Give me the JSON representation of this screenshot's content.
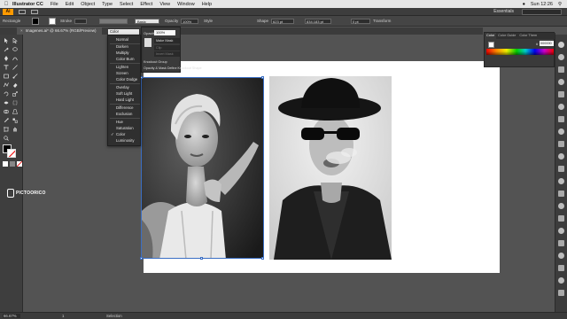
{
  "menubar": {
    "app_name": "Illustrator CC",
    "items": [
      "File",
      "Edit",
      "Object",
      "Type",
      "Select",
      "Effect",
      "View",
      "Window",
      "Help"
    ],
    "clock": "Sun 12:26"
  },
  "appbar": {
    "logo": "Ai",
    "workspace": "Essentials"
  },
  "controlbar": {
    "selection_label": "Rectangle",
    "stroke_label": "Stroke",
    "brush_value": "Basic",
    "opacity_label": "Opacity",
    "opacity_value": "100%",
    "style_label": "Style",
    "shape_label": "Shape",
    "w_value": "623 pt",
    "h_value": "834.183 pt",
    "angle_value": "0 pt",
    "transform_label": "Transform"
  },
  "document_tab": {
    "title": "Imagenes.ai* @ 66.67% (RGB/Preview)"
  },
  "blend": {
    "current": "Color",
    "modes": [
      "Normal",
      "Darken",
      "Multiply",
      "Color Burn",
      "Lighten",
      "Screen",
      "Color Dodge",
      "Overlay",
      "Soft Light",
      "Hard Light",
      "Difference",
      "Exclusion",
      "Hue",
      "Saturation",
      "Color",
      "Luminosity"
    ],
    "checked": "Color"
  },
  "transparency": {
    "opacity_label": "Opacity:",
    "opacity_value": "100%",
    "make_mask": "Make Mask",
    "clip": "Clip",
    "invert_mask": "Invert Mask",
    "knockout_group": "Knockout Group",
    "knockout_shape": "Opacity & Mask Define Knockout Shape"
  },
  "color_panel": {
    "tabs": [
      "Color",
      "Color Guide",
      "Color Them"
    ],
    "hex_value": "000000"
  },
  "watermark": {
    "text": "PICTOORICO"
  },
  "statusbar": {
    "zoom": "66.67%",
    "page": "1",
    "tool": "Selection"
  },
  "icons": {
    "accent": "#ff9a00",
    "selection_blue": "#3a6ec4"
  }
}
